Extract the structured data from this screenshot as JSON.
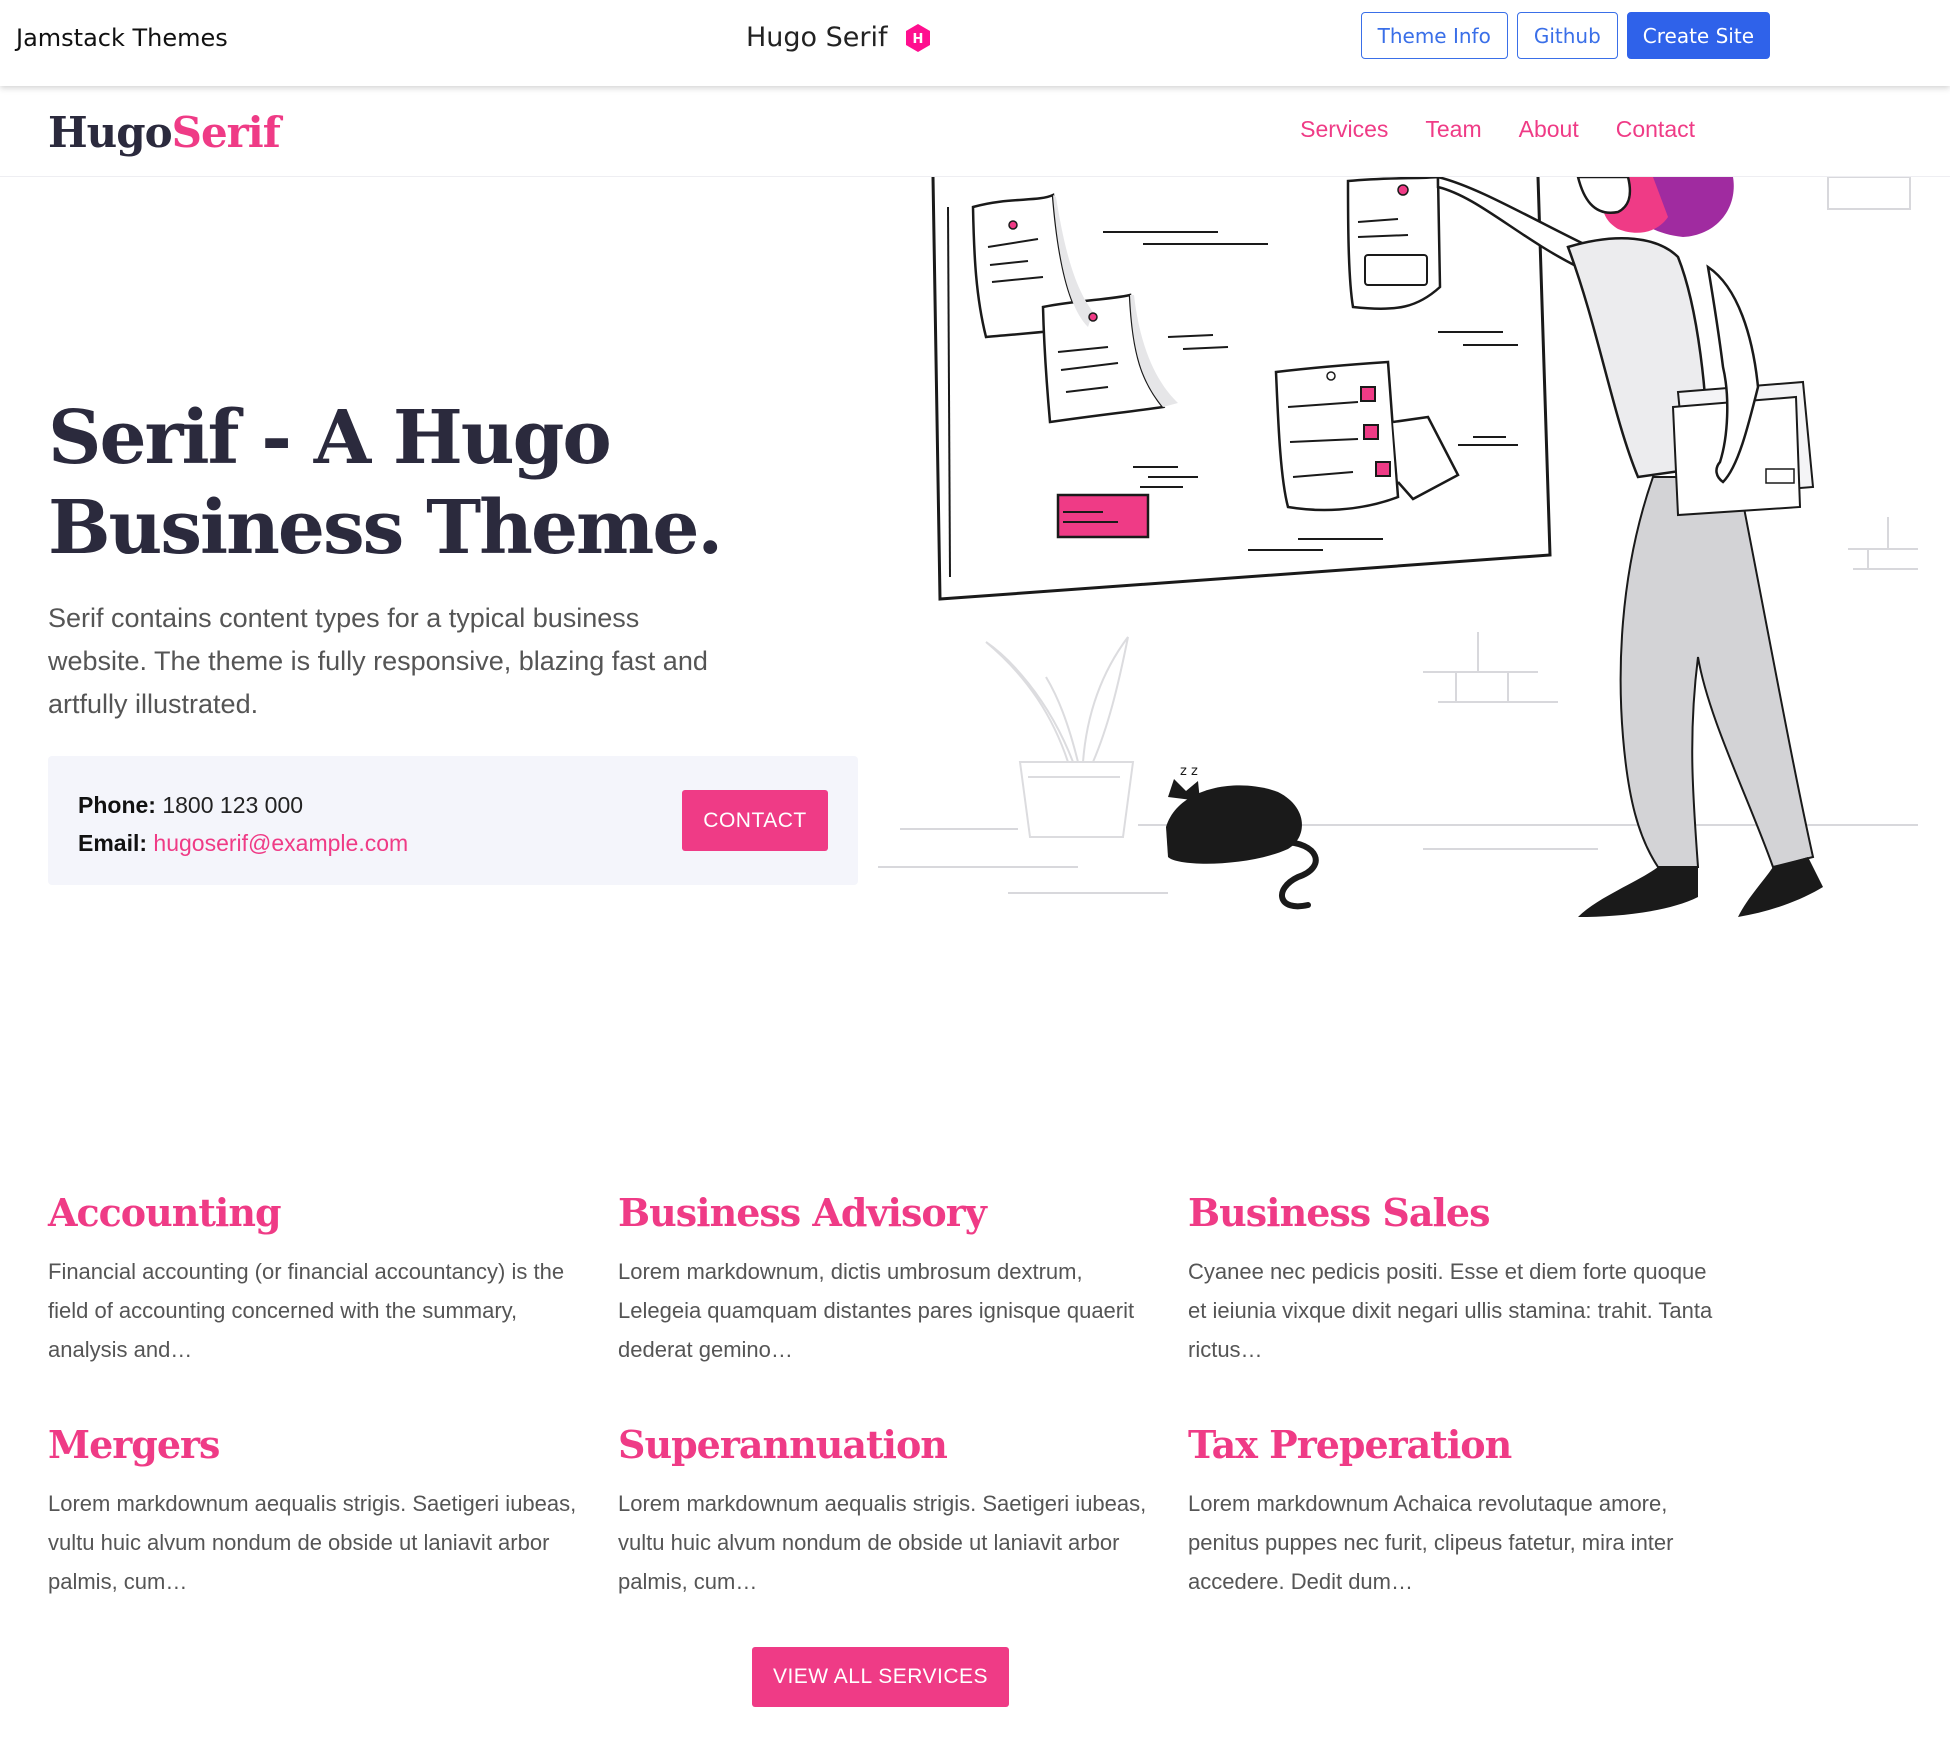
{
  "topbar": {
    "brand": "Jamstack Themes",
    "title": "Hugo Serif",
    "buttons": {
      "theme_info": "Theme Info",
      "github": "Github",
      "create_site": "Create Site"
    }
  },
  "header": {
    "logo_part1": "Hugo",
    "logo_part2": "Serif",
    "nav": [
      "Services",
      "Team",
      "About",
      "Contact"
    ]
  },
  "hero": {
    "title_line1": "Serif - A Hugo",
    "title_line2": "Business Theme.",
    "subtitle": "Serif contains content types for a typical business website. The theme is fully responsive, blazing fast and artfully illustrated.",
    "phone_label": "Phone:",
    "phone_value": "1800 123 000",
    "email_label": "Email:",
    "email_value": "hugoserif@example.com",
    "contact_button": "CONTACT"
  },
  "services": [
    {
      "title": "Accounting",
      "text": "Financial accounting (or financial accountancy) is the field of accounting concerned with the summary, analysis and…"
    },
    {
      "title": "Business Advisory",
      "text": "Lorem markdownum, dictis umbrosum dextrum, Lelegeia quamquam distantes pares ignisque quaerit dederat gemino…"
    },
    {
      "title": "Business Sales",
      "text": "Cyanee nec pedicis positi. Esse et diem forte quoque et ieiunia vixque dixit negari ullis stamina: trahit. Tanta rictus…"
    },
    {
      "title": "Mergers",
      "text": "Lorem markdownum aequalis strigis. Saetigeri iubeas, vultu huic alvum nondum de obside ut laniavit arbor palmis, cum…"
    },
    {
      "title": "Superannuation",
      "text": "Lorem markdownum aequalis strigis. Saetigeri iubeas, vultu huic alvum nondum de obside ut laniavit arbor palmis, cum…"
    },
    {
      "title": "Tax Preperation",
      "text": "Lorem markdownum Achaica revolutaque amore, penitus puppes nec furit, clipeus fatetur, mira inter accedere. Dedit dum…"
    }
  ],
  "view_all_button": "VIEW ALL SERVICES",
  "colors": {
    "accent": "#ef3b86",
    "primary_blue": "#2f62ea",
    "text_dark": "#2b2a3d"
  }
}
